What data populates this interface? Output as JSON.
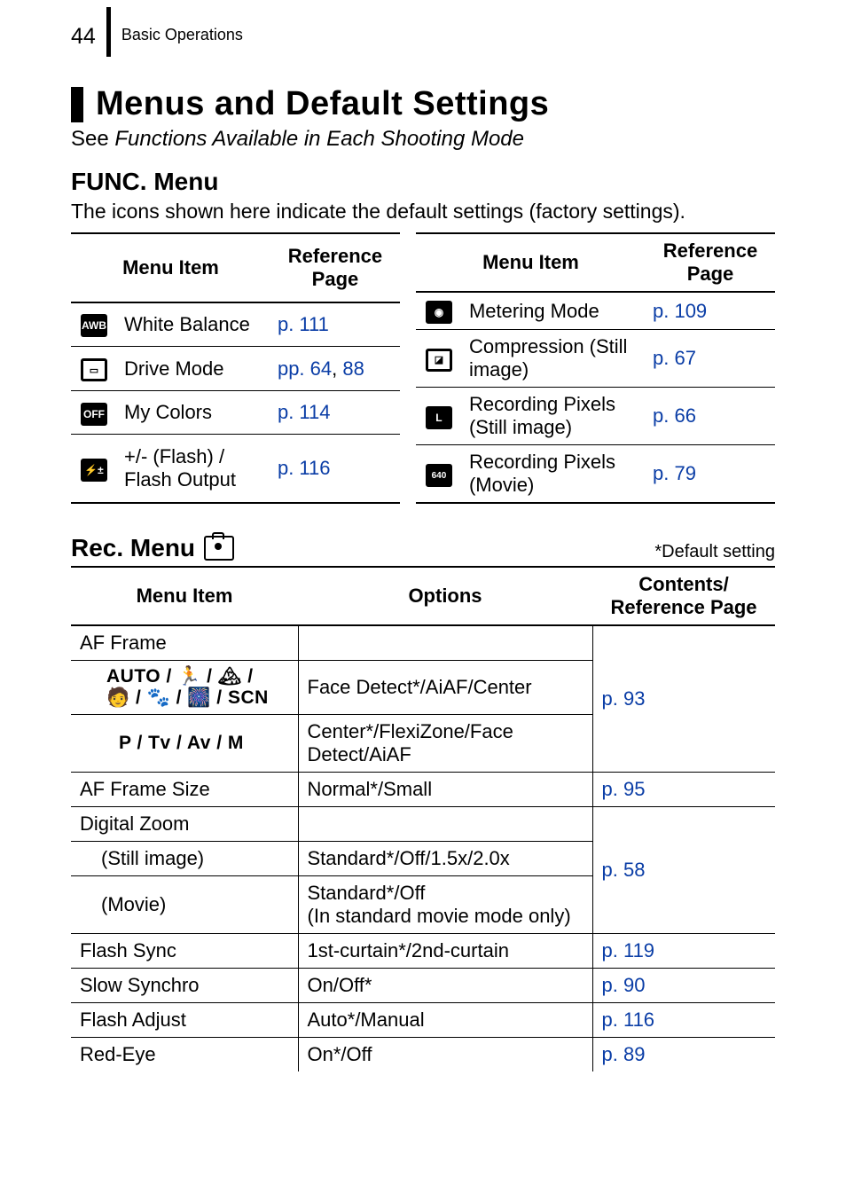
{
  "page_number": "44",
  "breadcrumb": "Basic Operations",
  "title": "Menus and Default Settings",
  "see_line_prefix": "See ",
  "see_line_italic": "Functions Available in Each Shooting Mode",
  "func": {
    "heading": "FUNC. Menu",
    "desc": "The icons shown here indicate the default settings (factory settings).",
    "col_menuitem": "Menu Item",
    "col_refpage": "Reference Page",
    "left": [
      {
        "icon": "AWB",
        "label": "White Balance",
        "ref_html": "p. 111"
      },
      {
        "icon": "▭",
        "label": "Drive Mode",
        "ref_prefix": "pp. ",
        "ref_a": "64",
        "ref_sep": ", ",
        "ref_b": "88"
      },
      {
        "icon": "OFF",
        "label": "My Colors",
        "ref_html": "p. 114"
      },
      {
        "icon": "⚡±",
        "label": "+/- (Flash) / Flash Output",
        "ref_html": "p. 116"
      }
    ],
    "right": [
      {
        "icon": "◉",
        "label": "Metering Mode",
        "ref_html": "p. 109"
      },
      {
        "icon": "◪",
        "label": "Compression (Still image)",
        "ref_html": "p. 67"
      },
      {
        "icon": "L",
        "label": "Recording Pixels (Still image)",
        "ref_html": "p. 66"
      },
      {
        "icon": "640",
        "label": "Recording Pixels (Movie)",
        "ref_html": "p. 79"
      }
    ]
  },
  "rec": {
    "heading": "Rec. Menu",
    "default_note": "*Default setting",
    "col_menuitem": "Menu Item",
    "col_options": "Options",
    "col_ref": "Contents/ Reference Page",
    "rows": {
      "af_frame": "AF Frame",
      "af_modes_line1": "AUTO / 🏃 / 🏔 /",
      "af_modes_line2": "🧑 / 🐾 / 🎆 / SCN",
      "af_face": "Face Detect*/AiAF/Center",
      "af_ptv": "P / Tv / Av / M",
      "af_center": "Center*/FlexiZone/Face Detect/AiAF",
      "af_ref": "p. 93",
      "af_size": "AF Frame Size",
      "af_size_opt": "Normal*/Small",
      "af_size_ref": "p. 95",
      "dz": "Digital Zoom",
      "dz_still": "(Still image)",
      "dz_still_opt": "Standard*/Off/1.5x/2.0x",
      "dz_movie": "(Movie)",
      "dz_movie_opt": "Standard*/Off\n(In standard movie mode only)",
      "dz_ref": "p. 58",
      "flash_sync": "Flash Sync",
      "flash_sync_opt": "1st-curtain*/2nd-curtain",
      "flash_sync_ref": "p. 119",
      "slow": "Slow Synchro",
      "slow_opt": "On/Off*",
      "slow_ref": "p. 90",
      "flash_adj": "Flash Adjust",
      "flash_adj_opt": "Auto*/Manual",
      "flash_adj_ref": "p. 116",
      "redeye": "Red-Eye",
      "redeye_opt": "On*/Off",
      "redeye_ref": "p. 89"
    }
  }
}
